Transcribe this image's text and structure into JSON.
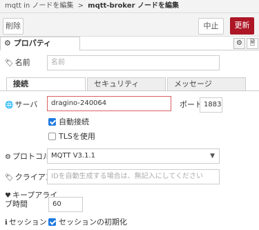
{
  "breadcrumb": {
    "parent": "mqtt in ノードを編集",
    "separator": ">",
    "current": "mqtt-broker ノードを編集"
  },
  "toolbar": {
    "delete_label": "削除",
    "cancel_label": "中止",
    "update_label": "更新"
  },
  "properties_tab": {
    "label": "プロパティ",
    "icon": "gear-icon"
  },
  "side_buttons": {
    "settings_icon": "gear-icon",
    "description_icon": "document-icon"
  },
  "name_field": {
    "label": "名前",
    "icon": "tag-icon",
    "placeholder": "名前",
    "value": ""
  },
  "tabs": [
    {
      "label": "接続",
      "active": true
    },
    {
      "label": "セキュリティ",
      "active": false
    },
    {
      "label": "メッセージ",
      "active": false
    }
  ],
  "server": {
    "label": "サーバ",
    "icon": "globe-icon",
    "value": "dragino-240064",
    "port_label": "ポート",
    "port_value": "1883"
  },
  "auto_connect": {
    "label": "自動接続",
    "checked": true
  },
  "tls": {
    "label": "TLSを使用",
    "checked": false
  },
  "protocol": {
    "label": "プロトコル",
    "icon": "gear-icon",
    "selected": "MQTT V3.1.1"
  },
  "client": {
    "label": "クライアント",
    "icon": "tag-icon",
    "placeholder": "IDを自動生成する場合は、無記入にしてください",
    "value": ""
  },
  "keepalive": {
    "label_line1": "キープアライ",
    "label_line2": "ブ時間",
    "icon": "heartbeat-icon",
    "value": "60"
  },
  "session": {
    "label": "セッション",
    "icon": "info-icon",
    "checkbox_label": "セッションの初期化",
    "checked": true
  },
  "colors": {
    "accent": "#ad1625",
    "checkbox": "#1f7ae0",
    "error_border": "#d6615f"
  }
}
